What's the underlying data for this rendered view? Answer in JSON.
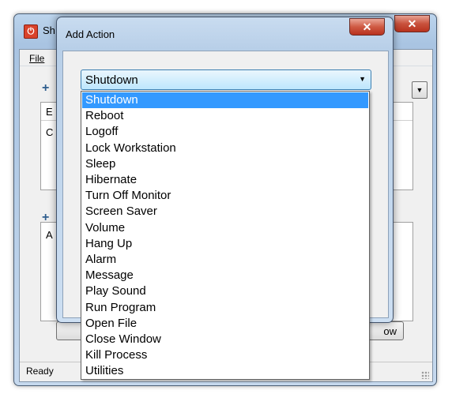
{
  "main_window": {
    "title": "Sh",
    "close_symbol": "✕",
    "menu_file": "File",
    "upper_panel_header": "E",
    "upper_panel_row": "C",
    "lower_panel_header": "A",
    "button_partial": "ow",
    "status": "Ready"
  },
  "dialog": {
    "title": "Add Action",
    "close_symbol": "✕",
    "selected_value": "Shutdown",
    "options": [
      "Shutdown",
      "Reboot",
      "Logoff",
      "Lock Workstation",
      "Sleep",
      "Hibernate",
      "Turn Off Monitor",
      "Screen Saver",
      "Volume",
      "Hang Up",
      "Alarm",
      "Message",
      "Play Sound",
      "Run Program",
      "Open File",
      "Close Window",
      "Kill Process",
      "Utilities"
    ],
    "highlighted_index": 0
  },
  "icons": {
    "app_icon": "app-power-icon",
    "add_icon": "plus-icon",
    "dropdown_arrow": "chevron-down-icon"
  },
  "colors": {
    "highlight": "#3399ff",
    "close_button": "#c9523d"
  }
}
